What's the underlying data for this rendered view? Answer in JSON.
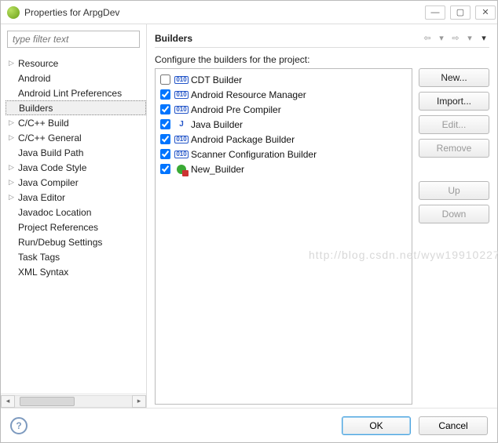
{
  "window": {
    "title": "Properties for ArpgDev"
  },
  "filter": {
    "placeholder": "type filter text"
  },
  "tree": {
    "items": [
      {
        "label": "Resource",
        "expandable": true
      },
      {
        "label": "Android",
        "expandable": false
      },
      {
        "label": "Android Lint Preferences",
        "expandable": false
      },
      {
        "label": "Builders",
        "expandable": false,
        "selected": true
      },
      {
        "label": "C/C++ Build",
        "expandable": true
      },
      {
        "label": "C/C++ General",
        "expandable": true
      },
      {
        "label": "Java Build Path",
        "expandable": false
      },
      {
        "label": "Java Code Style",
        "expandable": true
      },
      {
        "label": "Java Compiler",
        "expandable": true
      },
      {
        "label": "Java Editor",
        "expandable": true
      },
      {
        "label": "Javadoc Location",
        "expandable": false
      },
      {
        "label": "Project References",
        "expandable": false
      },
      {
        "label": "Run/Debug Settings",
        "expandable": false
      },
      {
        "label": "Task Tags",
        "expandable": false
      },
      {
        "label": "XML Syntax",
        "expandable": false
      }
    ]
  },
  "page": {
    "heading": "Builders",
    "caption": "Configure the builders for the project:",
    "builders": [
      {
        "name": "CDT Builder",
        "checked": false,
        "icon": "010"
      },
      {
        "name": "Android Resource Manager",
        "checked": true,
        "icon": "010"
      },
      {
        "name": "Android Pre Compiler",
        "checked": true,
        "icon": "010"
      },
      {
        "name": "Java Builder",
        "checked": true,
        "icon": "j"
      },
      {
        "name": "Android Package Builder",
        "checked": true,
        "icon": "010"
      },
      {
        "name": "Scanner Configuration Builder",
        "checked": true,
        "icon": "010"
      },
      {
        "name": "New_Builder",
        "checked": true,
        "icon": "green"
      }
    ],
    "buttons": {
      "new": "New...",
      "import": "Import...",
      "edit": "Edit...",
      "remove": "Remove",
      "up": "Up",
      "down": "Down"
    }
  },
  "dialog": {
    "ok": "OK",
    "cancel": "Cancel"
  },
  "watermark": "http://blog.csdn.net/wyw19910227"
}
